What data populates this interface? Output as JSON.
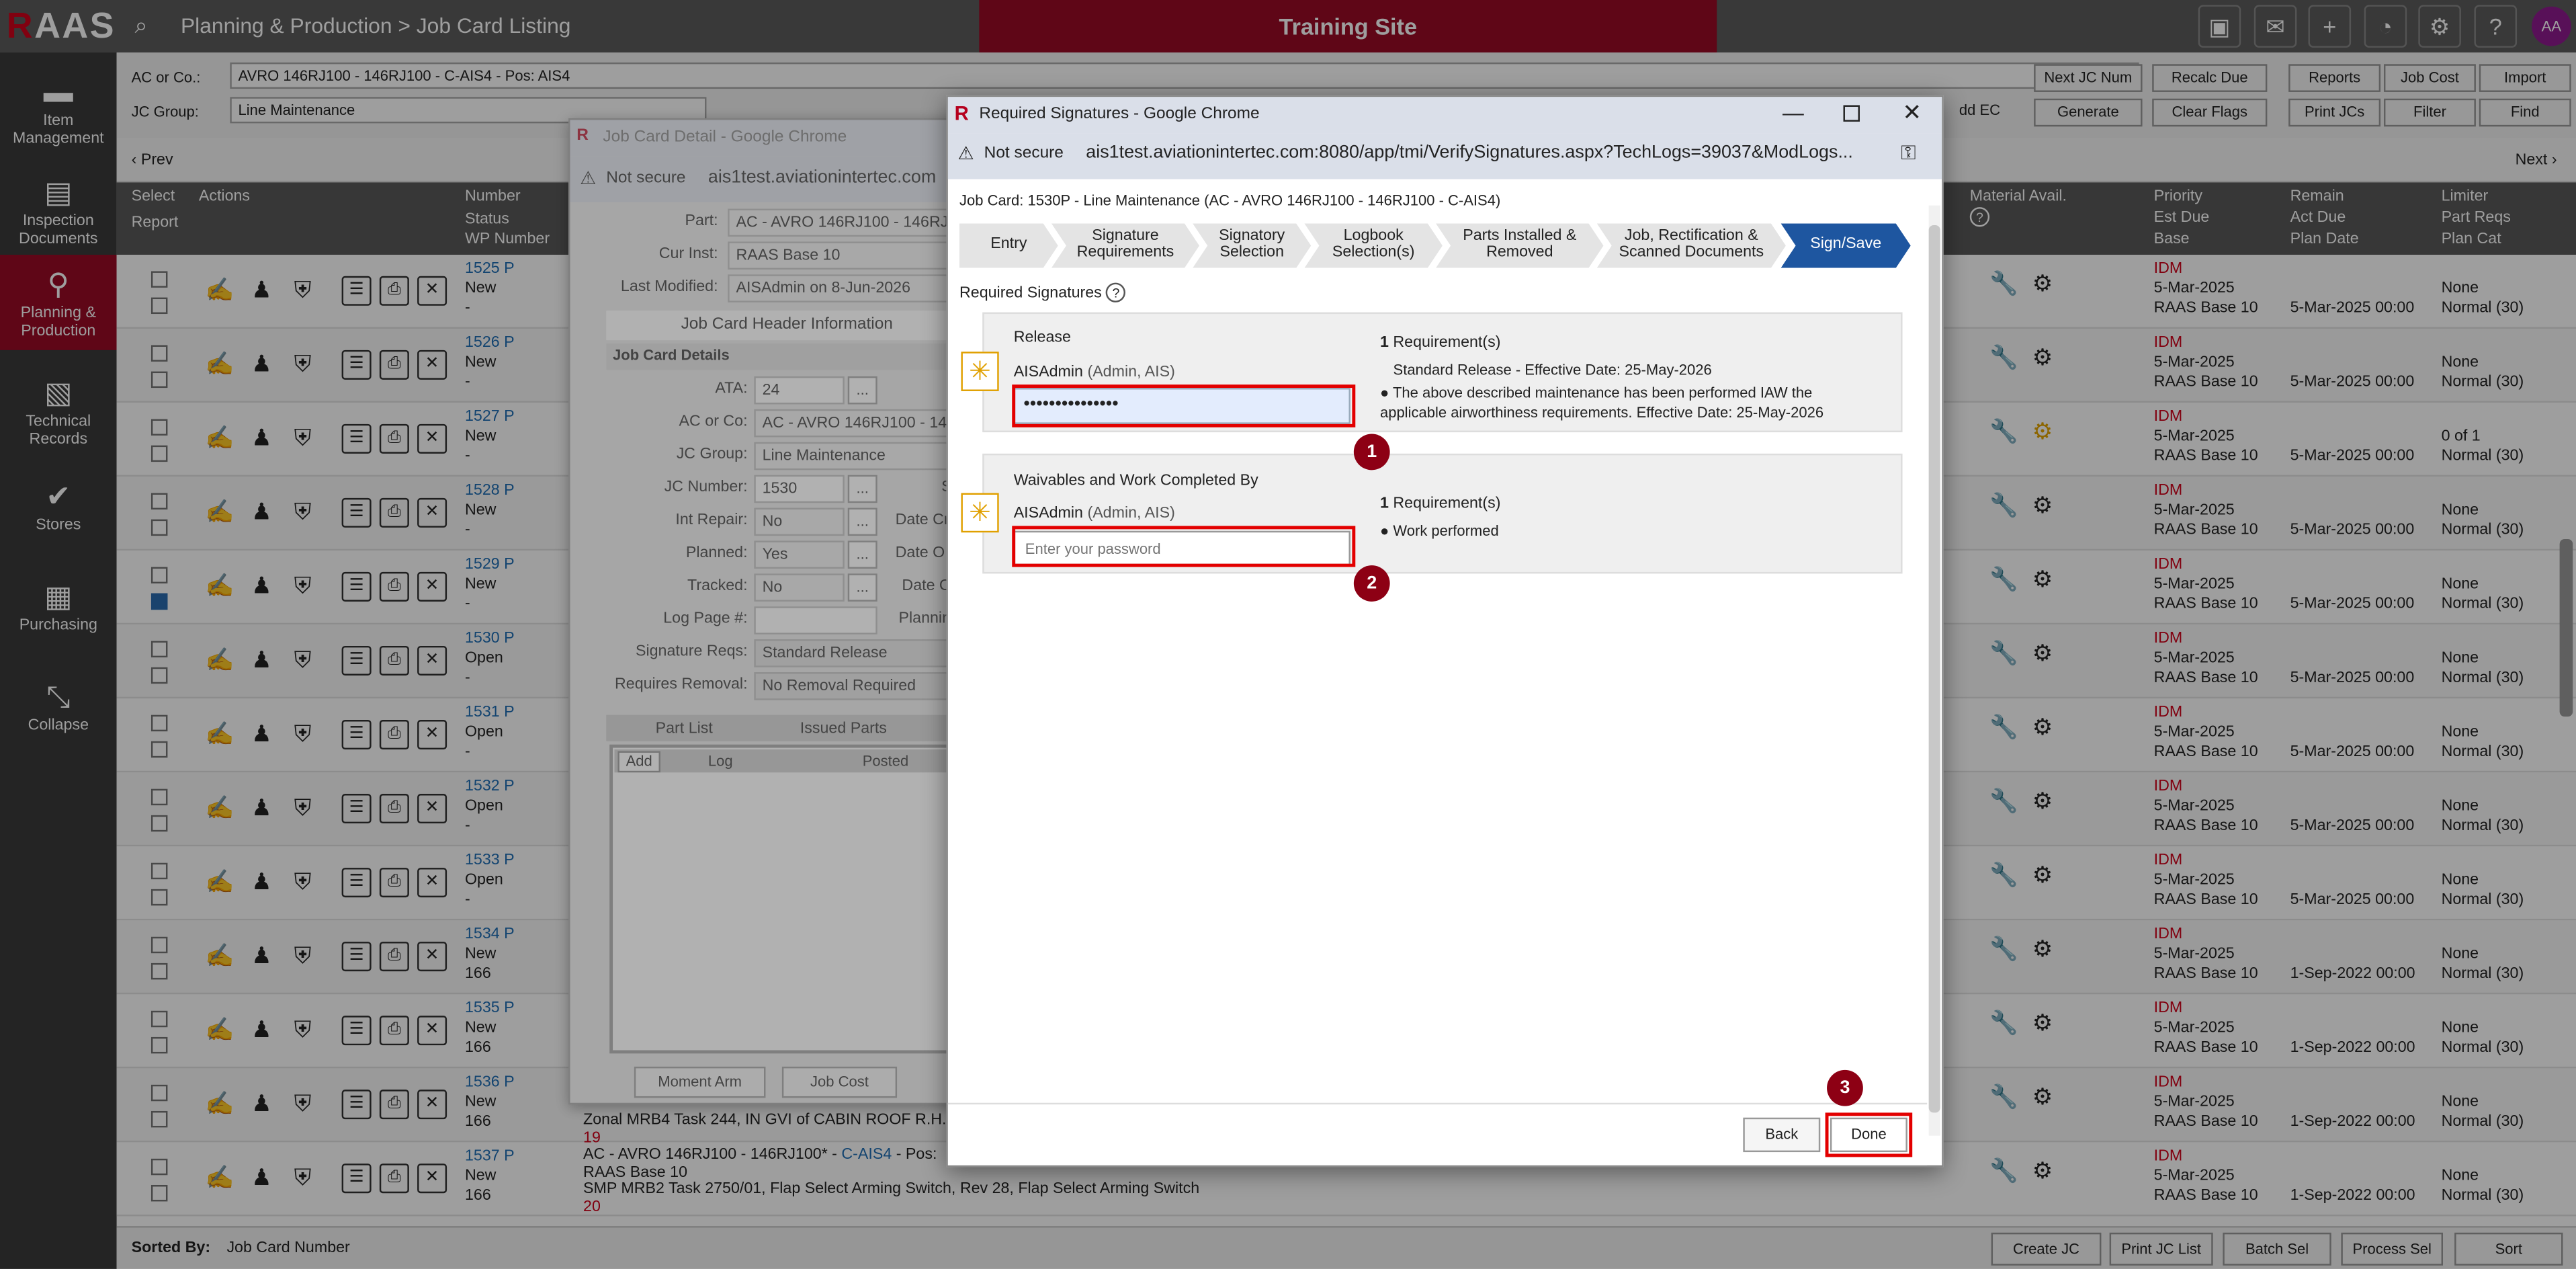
{
  "app": {
    "logo_r": "R",
    "logo_rest": "AAS",
    "breadcrumb": "Planning & Production > Job Card Listing",
    "site": "Training Site",
    "avatar": "AA"
  },
  "sidebar": {
    "items": [
      {
        "label": "Item Management",
        "icon": "folder-icon"
      },
      {
        "label": "Inspection Documents",
        "icon": "document-icon"
      },
      {
        "label": "Planning & Production",
        "icon": "flow-icon"
      },
      {
        "label": "Technical Records",
        "icon": "records-icon"
      },
      {
        "label": "Stores",
        "icon": "clipboard-icon"
      },
      {
        "label": "Purchasing",
        "icon": "calculator-icon"
      },
      {
        "label": "Collapse",
        "icon": "collapse-icon"
      }
    ]
  },
  "controls": {
    "ac_label": "AC or Co.:",
    "ac_value": "AVRO 146RJ100 - 146RJ100 - C-AIS4 - Pos: AIS4",
    "group_label": "JC Group:",
    "group_value": "Line Maintenance",
    "buttons": [
      "Next JC Num",
      "Recalc Due",
      "Reports",
      "Job Cost",
      "Import",
      "dd EC",
      "Generate",
      "Clear Flags",
      "Print JCs",
      "Filter",
      "Find"
    ]
  },
  "nav": {
    "prev": "Prev",
    "next": "Next"
  },
  "headers": {
    "select": "Select",
    "actions": "Actions",
    "report": "Report",
    "number": "Number",
    "status": "Status",
    "wp": "WP Number",
    "material": "Material Avail.",
    "priority": "Priority",
    "est_due": "Est Due",
    "base": "Base",
    "remain": "Remain",
    "act_due": "Act Due",
    "plan_date": "Plan Date",
    "limiter": "Limiter",
    "part_reqs": "Part Reqs",
    "plan_cat": "Plan Cat"
  },
  "rows": [
    {
      "num": "1525 P",
      "status": "New",
      "wp": "-",
      "pri": "IDM",
      "est": "5-Mar-2025",
      "base": "RAAS Base 10",
      "plan": "5-Mar-2025 00:00",
      "lim": "None",
      "cat": "Normal (30)",
      "checked": false
    },
    {
      "num": "1526 P",
      "status": "New",
      "wp": "-",
      "pri": "IDM",
      "est": "5-Mar-2025",
      "base": "RAAS Base 10",
      "plan": "5-Mar-2025 00:00",
      "lim": "None",
      "cat": "Normal (30)",
      "checked": false
    },
    {
      "num": "1527 P",
      "status": "New",
      "wp": "-",
      "pri": "IDM",
      "est": "5-Mar-2025",
      "base": "RAAS Base 10",
      "plan": "5-Mar-2025 00:00",
      "lim": "0 of 1",
      "cat": "Normal (30)",
      "checked": false
    },
    {
      "num": "1528 P",
      "status": "New",
      "wp": "-",
      "pri": "IDM",
      "est": "5-Mar-2025",
      "base": "RAAS Base 10",
      "plan": "5-Mar-2025 00:00",
      "lim": "None",
      "cat": "Normal (30)",
      "checked": false
    },
    {
      "num": "1529 P",
      "status": "New",
      "wp": "-",
      "pri": "IDM",
      "est": "5-Mar-2025",
      "base": "RAAS Base 10",
      "plan": "5-Mar-2025 00:00",
      "lim": "None",
      "cat": "Normal (30)",
      "checked": true
    },
    {
      "num": "1530 P",
      "status": "Open",
      "wp": "-",
      "pri": "IDM",
      "est": "5-Mar-2025",
      "base": "RAAS Base 10",
      "plan": "5-Mar-2025 00:00",
      "lim": "None",
      "cat": "Normal (30)",
      "checked": false
    },
    {
      "num": "1531 P",
      "status": "Open",
      "wp": "-",
      "pri": "IDM",
      "est": "5-Mar-2025",
      "base": "RAAS Base 10",
      "plan": "5-Mar-2025 00:00",
      "lim": "None",
      "cat": "Normal (30)",
      "checked": false
    },
    {
      "num": "1532 P",
      "status": "Open",
      "wp": "-",
      "pri": "IDM",
      "est": "5-Mar-2025",
      "base": "RAAS Base 10",
      "plan": "5-Mar-2025 00:00",
      "lim": "None",
      "cat": "Normal (30)",
      "checked": false
    },
    {
      "num": "1533 P",
      "status": "Open",
      "wp": "-",
      "pri": "IDM",
      "est": "5-Mar-2025",
      "base": "RAAS Base 10",
      "plan": "5-Mar-2025 00:00",
      "lim": "None",
      "cat": "Normal (30)",
      "checked": false
    },
    {
      "num": "1534 P",
      "status": "New",
      "wp": "166",
      "pri": "IDM",
      "est": "5-Mar-2025",
      "base": "RAAS Base 10",
      "plan": "1-Sep-2022 00:00",
      "lim": "None",
      "cat": "Normal (30)",
      "checked": false
    },
    {
      "num": "1535 P",
      "status": "New",
      "wp": "166",
      "pri": "IDM",
      "est": "5-Mar-2025",
      "base": "RAAS Base 10",
      "plan": "1-Sep-2022 00:00",
      "lim": "None",
      "cat": "Normal (30)",
      "checked": false
    },
    {
      "num": "1536 P",
      "status": "New",
      "wp": "166",
      "pri": "IDM",
      "est": "5-Mar-2025",
      "base": "RAAS Base 10",
      "plan": "1-Sep-2022 00:00",
      "lim": "None",
      "cat": "Normal (30)",
      "checked": false
    },
    {
      "num": "1537 P",
      "status": "New",
      "wp": "166",
      "pri": "IDM",
      "est": "5-Mar-2025",
      "base": "RAAS Base 10",
      "plan": "1-Sep-2022 00:00",
      "lim": "None",
      "cat": "Normal (30)",
      "checked": false
    }
  ],
  "row_notes": {
    "r1536_desc": "Zonal MRB4 Task 244, IN GVI of CABIN ROOF R.H.",
    "r1536_num": "19",
    "r1537_ac": "AC - AVRO 146RJ100 - 146RJ100* - ",
    "r1537_link": "C-AIS4",
    "r1537_pos": " - Pos:",
    "r1537_base": "RAAS Base 10",
    "r1537_desc": "SMP MRB2 Task 2750/01, Flap Select Arming Switch, Rev 28, Flap Select Arming Switch",
    "r1537_num": "20"
  },
  "footer": {
    "sorted_label": "Sorted By:",
    "sorted_value": "Job Card Number",
    "buttons": [
      "Create JC",
      "Print JC List",
      "Batch Sel",
      "Process Sel",
      "Sort"
    ]
  },
  "jobcard": {
    "title": "Job Card Detail - Google Chrome",
    "not_secure": "Not secure",
    "url": "ais1test.aviationintertec.com",
    "part_label": "Part:",
    "part": "AC - AVRO 146RJ100 - 146RJ",
    "curinst_label": "Cur Inst:",
    "curinst": "RAAS Base 10",
    "lastmod_label": "Last Modified:",
    "lastmod": "AISAdmin on 8-Jun-2026",
    "header_info": "Job Card Header Information",
    "details": "Job Card Details",
    "ata_label": "ATA:",
    "ata": "24",
    "acco_label": "AC or Co:",
    "acco": "AC - AVRO 146RJ100 - 14",
    "group_label": "JC Group:",
    "group": "Line Maintenance",
    "jcnum_label": "JC Number:",
    "jcnum": "1530",
    "intrepair_label": "Int Repair:",
    "intrepair": "No",
    "planned_label": "Planned:",
    "planned": "Yes",
    "tracked_label": "Tracked:",
    "tracked": "No",
    "logpage_label": "Log Page #:",
    "sigreqs_label": "Signature Reqs:",
    "sigreqs": "Standard Release",
    "reqrem_label": "Requires Removal:",
    "reqrem": "No Removal Required",
    "date_cr": "Date Cr",
    "date_op": "Date O",
    "date_c": "Date C",
    "planning": "Plannin",
    "s": "S",
    "tab_parts": "Part List",
    "tab_issued": "Issued Parts",
    "col_add": "Add",
    "col_log": "Log",
    "col_posted": "Posted",
    "btn_moment": "Moment Arm",
    "btn_cost": "Job Cost",
    "ellipsis": "..."
  },
  "sig": {
    "title": "Required Signatures - Google Chrome",
    "not_secure": "Not secure",
    "url": "ais1test.aviationintertec.com:8080/app/tmi/VerifySignatures.aspx?TechLogs=39037&ModLogs...",
    "jobcard": "Job Card: 1530P - Line Maintenance  (AC - AVRO 146RJ100 - 146RJ100 - C-AIS4)",
    "steps": [
      "Entry",
      "Signature Requirements",
      "Signatory Selection",
      "Logbook Selection(s)",
      "Parts Installed & Removed",
      "Job, Rectification & Scanned Documents",
      "Sign/Save"
    ],
    "section_title": "Required Signatures",
    "release": {
      "title": "Release",
      "user": "AISAdmin",
      "user_sub": "(Admin, AIS)",
      "password": "•••••••••••••••",
      "req_count": "1",
      "req_label": " Requirement(s)",
      "std_release": "Standard Release - Effective Date:  25-May-2026",
      "bullet": "The above described maintenance has been performed IAW the applicable airworthiness requirements. Effective Date: 25-May-2026"
    },
    "waivables": {
      "title": "Waivables and Work Completed By",
      "user": "AISAdmin",
      "user_sub": "(Admin, AIS)",
      "placeholder": "Enter your password",
      "req_count": "1",
      "req_label": " Requirement(s)",
      "bullet": "Work performed"
    },
    "back": "Back",
    "done": "Done",
    "badges": [
      "1",
      "2",
      "3"
    ]
  }
}
